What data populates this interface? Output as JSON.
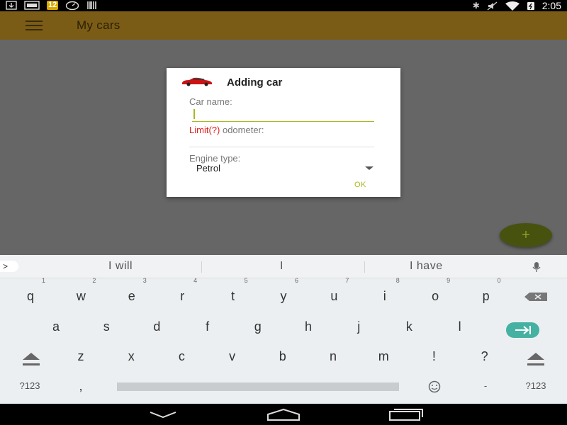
{
  "status_bar": {
    "badge": "12",
    "time": "2:05"
  },
  "app_bar": {
    "title": "My cars"
  },
  "dialog": {
    "title": "Adding car",
    "car_name_label": "Car name:",
    "car_name_value": "",
    "limit_link": "Limit(?)",
    "odometer_label": "odometer:",
    "odometer_value": "",
    "engine_label": "Engine type:",
    "engine_value": "Petrol",
    "ok_label": "OK"
  },
  "fab": {
    "label": "+"
  },
  "keyboard": {
    "suggestions": [
      "I will",
      "I",
      "I have"
    ],
    "row1": [
      {
        "k": "q",
        "n": "1"
      },
      {
        "k": "w",
        "n": "2"
      },
      {
        "k": "e",
        "n": "3"
      },
      {
        "k": "r",
        "n": "4"
      },
      {
        "k": "t",
        "n": "5"
      },
      {
        "k": "y",
        "n": "6"
      },
      {
        "k": "u",
        "n": "7"
      },
      {
        "k": "i",
        "n": "8"
      },
      {
        "k": "o",
        "n": "9"
      },
      {
        "k": "p",
        "n": "0"
      }
    ],
    "row2": [
      "a",
      "s",
      "d",
      "f",
      "g",
      "h",
      "j",
      "k",
      "l"
    ],
    "row3": [
      "z",
      "x",
      "c",
      "v",
      "b",
      "n",
      "m",
      "!",
      "?"
    ],
    "symbols_left": "?123",
    "comma": ",",
    "dash": "-",
    "symbols_right": "?123"
  },
  "colors": {
    "app_bar": "#7a5c16",
    "accent": "#a8b820",
    "fab": "#47520f",
    "error": "#e02020",
    "enter_key": "#45b1a3"
  }
}
